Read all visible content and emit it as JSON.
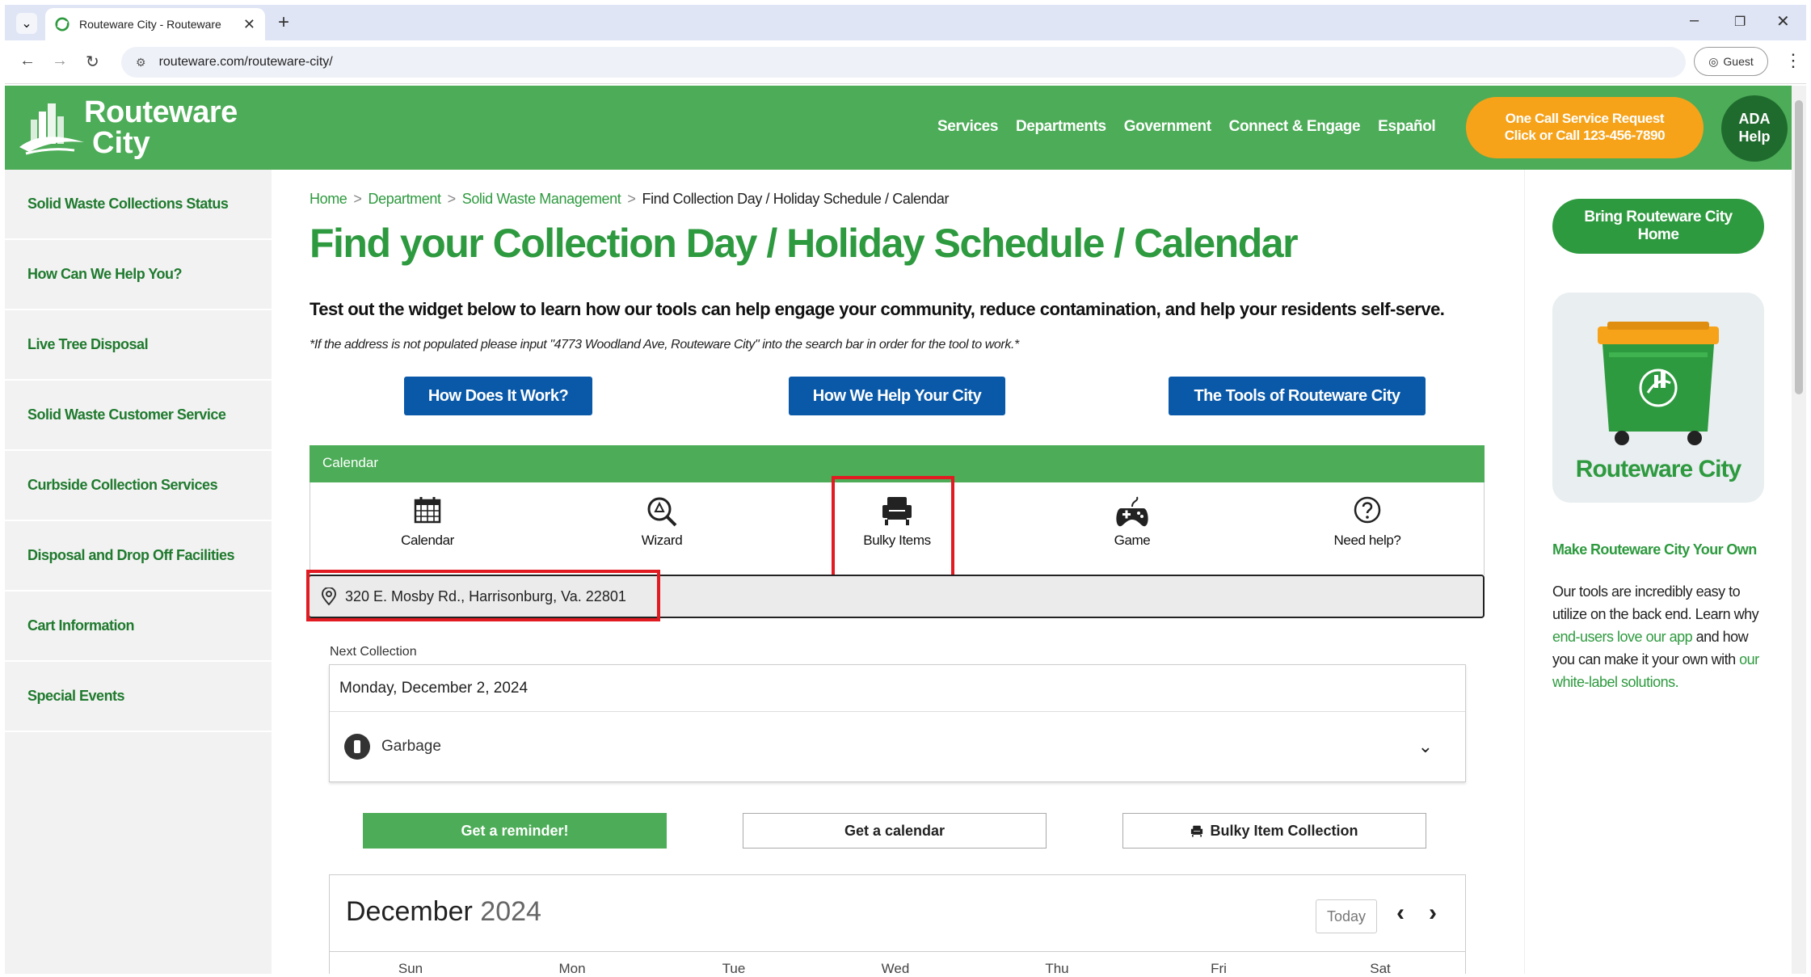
{
  "browser": {
    "tab_title": "Routeware City - Routeware",
    "url": "routeware.com/routeware-city/",
    "profile_label": "Guest"
  },
  "header": {
    "logo_line1": "Routeware",
    "logo_line2": "City",
    "nav": [
      "Services",
      "Departments",
      "Government",
      "Connect & Engage",
      "Español"
    ],
    "one_call_line1": "One Call Service Request",
    "one_call_line2": "Click or Call 123-456-7890",
    "ada_line1": "ADA",
    "ada_line2": "Help"
  },
  "sidebar": {
    "items": [
      "Solid Waste Collections Status",
      "How Can We Help You?",
      "Live Tree Disposal",
      "Solid Waste Customer Service",
      "Curbside Collection Services",
      "Disposal and Drop Off Facilities",
      "Cart Information",
      "Special Events"
    ]
  },
  "main": {
    "breadcrumb": {
      "home": "Home",
      "department": "Department",
      "swm": "Solid Waste Management",
      "current": "Find Collection Day / Holiday Schedule / Calendar"
    },
    "title": "Find your Collection Day / Holiday Schedule / Calendar",
    "lede": "Test out the widget below to learn how our tools can help engage your community, reduce contamination, and help your residents self-serve.",
    "note": "*If the address is not populated please input \"4773 Woodland Ave, Routeware City\" into the search bar in order for the tool to work.*",
    "buttons": [
      "How Does It Work?",
      "How We Help Your City",
      "The Tools of Routeware City"
    ]
  },
  "widget": {
    "bar_title": "Calendar",
    "tabs": [
      "Calendar",
      "Wizard",
      "Bulky Items",
      "Game",
      "Need help?"
    ],
    "address": "320 E. Mosby Rd., Harrisonburg, Va. 22801",
    "next_label": "Next Collection",
    "next_date": "Monday, December 2, 2024",
    "next_type": "Garbage",
    "actions": {
      "reminder": "Get a reminder!",
      "calendar": "Get a calendar",
      "bulky": "Bulky Item Collection"
    },
    "calendar": {
      "month": "December",
      "year": "2024",
      "today": "Today",
      "days": [
        "Sun",
        "Mon",
        "Tue",
        "Wed",
        "Thu",
        "Fri",
        "Sat"
      ]
    }
  },
  "aside": {
    "bring_line1": "Bring Routeware City",
    "bring_line2": "Home",
    "promo_name": "Routeware City",
    "heading": "Make Routeware City Your Own",
    "p1": "Our tools are incredibly easy to utilize on the back end. Learn why ",
    "link1": "end-users love our app",
    "p2": " and how you can make it your own with ",
    "link2": "our white-label solutions."
  },
  "colors": {
    "brand_green": "#4cac57",
    "dark_green": "#2e9a3f",
    "accent_orange": "#f6a31a",
    "button_blue": "#0a59a8",
    "highlight_red": "#e21a22"
  }
}
